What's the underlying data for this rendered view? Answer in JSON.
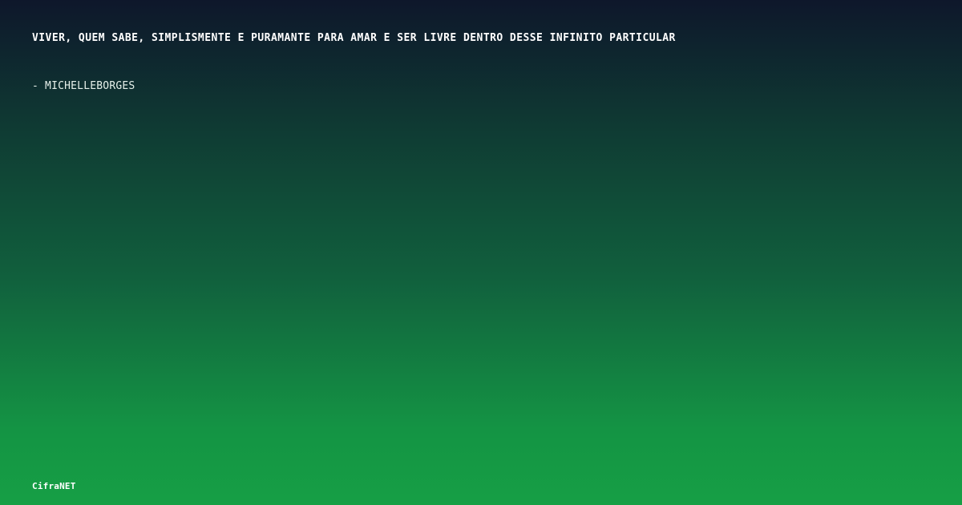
{
  "quote": {
    "text": "VIVER, QUEM SABE, SIMPLISMENTE E PURAMANTE PARA AMAR E SER LIVRE DENTRO DESSE INFINITO PARTICULAR"
  },
  "author": {
    "text": "- MICHELLEBORGES"
  },
  "brand": {
    "name": "CifraNET"
  },
  "colors": {
    "gradient_top": "#0e172b",
    "gradient_bottom": "#169f45",
    "text": "#ffffff"
  }
}
